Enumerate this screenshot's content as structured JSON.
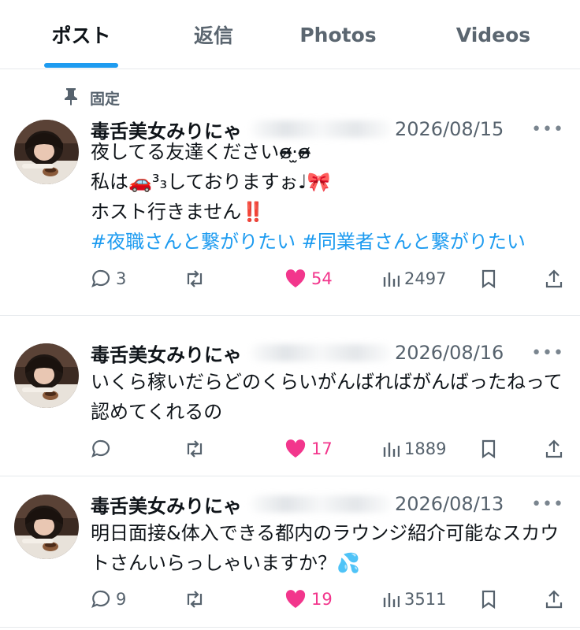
{
  "tabs": [
    {
      "label": "ポスト",
      "active": true
    },
    {
      "label": "返信",
      "active": false
    },
    {
      "label": "Photos",
      "active": false
    },
    {
      "label": "Videos",
      "active": false
    }
  ],
  "pinned_label": "固定",
  "posts": [
    {
      "author": "毒舌美女みりにゃ",
      "date": "2026/08/15",
      "lines": [
        "夜してる友達くださいɞ̴̶̷·̫ɞ̴̶̷",
        "私は🚗³₃しておりますぉ♩🎀",
        "ホスト行きません‼️"
      ],
      "hashtags": "#夜職さんと繋がりたい #同業者さんと繋がりたい",
      "replies": "3",
      "likes": "54",
      "views": "2497"
    },
    {
      "author": "毒舌美女みりにゃ",
      "date": "2026/08/16",
      "text": "いくら稼いだらどのくらいがんばればがんばったねって認めてくれるの",
      "replies": "",
      "likes": "17",
      "views": "1889"
    },
    {
      "author": "毒舌美女みりにゃ",
      "date": "2026/08/13",
      "text": "明日面接&体入できる都内のラウンジ紹介可能なスカウトさんいらっしゃいますか？💦",
      "replies": "9",
      "likes": "19",
      "views": "3511"
    }
  ],
  "icons": {
    "pin": "pin-icon",
    "reply": "reply-icon",
    "repost": "repost-icon",
    "like": "heart-icon",
    "views": "views-icon",
    "bookmark": "bookmark-icon",
    "share": "share-icon",
    "more": "more-icon"
  },
  "colors": {
    "accent": "#1d9bf0",
    "like": "#f2368c",
    "muted": "#56626d"
  }
}
